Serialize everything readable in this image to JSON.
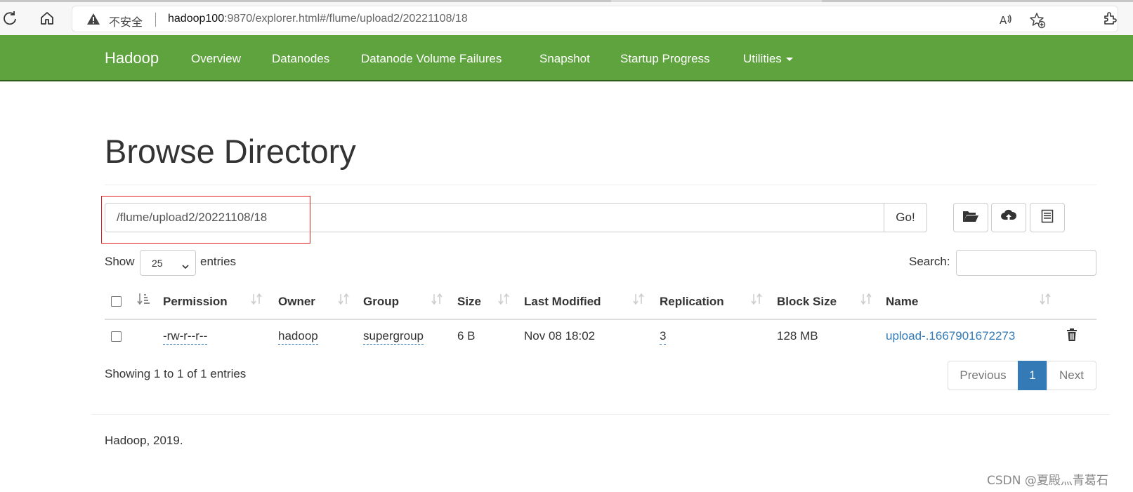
{
  "browser": {
    "security_label": "不安全",
    "url_host": "hadoop100",
    "url_rest": ":9870/explorer.html#/flume/upload2/20221108/18"
  },
  "navbar": {
    "brand": "Hadoop",
    "links": [
      "Overview",
      "Datanodes",
      "Datanode Volume Failures",
      "Snapshot",
      "Startup Progress",
      "Utilities"
    ],
    "bg_color": "#5fa33e"
  },
  "page": {
    "title": "Browse Directory",
    "path_value": "/flume/upload2/20221108/18",
    "go_label": "Go!",
    "show_label": "Show",
    "entries_value": "25",
    "entries_label": "entries",
    "search_label": "Search:",
    "search_value": ""
  },
  "table": {
    "columns": [
      "Permission",
      "Owner",
      "Group",
      "Size",
      "Last Modified",
      "Replication",
      "Block Size",
      "Name"
    ],
    "rows": [
      {
        "permission": "-rw-r--r--",
        "owner": "hadoop",
        "group": "supergroup",
        "size": "6 B",
        "last_modified": "Nov 08 18:02",
        "replication": "3",
        "block_size": "128 MB",
        "name": "upload-.1667901672273"
      }
    ]
  },
  "pagination": {
    "summary": "Showing 1 to 1 of 1 entries",
    "previous": "Previous",
    "current": "1",
    "next": "Next",
    "active_color": "#337ab7"
  },
  "footer": {
    "text": "Hadoop, 2019."
  },
  "watermark": "CSDN @夏殿灬青葛石"
}
